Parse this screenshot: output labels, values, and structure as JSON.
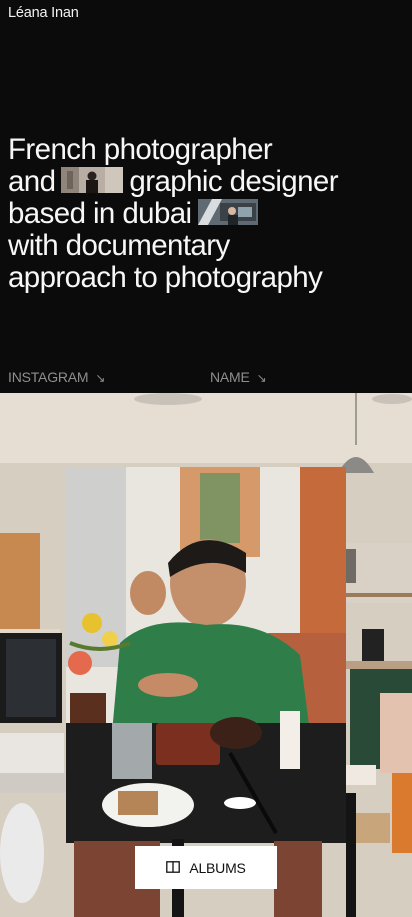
{
  "header": {
    "brand": "Léana Inan"
  },
  "hero": {
    "line1": "French photographer",
    "line2a": "and",
    "line2b": "graphic designer",
    "line3": "based in dubai",
    "line4": "with documentary",
    "line5": "approach to photography"
  },
  "links": [
    {
      "label": "INSTAGRAM",
      "icon": "arrow-down-right-icon"
    },
    {
      "label": "NAME",
      "icon": "arrow-down-right-icon"
    }
  ],
  "featured": {
    "button_label": "ALBUMS",
    "button_icon": "book-open-icon"
  },
  "colors": {
    "background": "#0b0b0b",
    "text": "#f2f2f2",
    "muted": "#8e8e8e",
    "button": "#ffffff"
  }
}
